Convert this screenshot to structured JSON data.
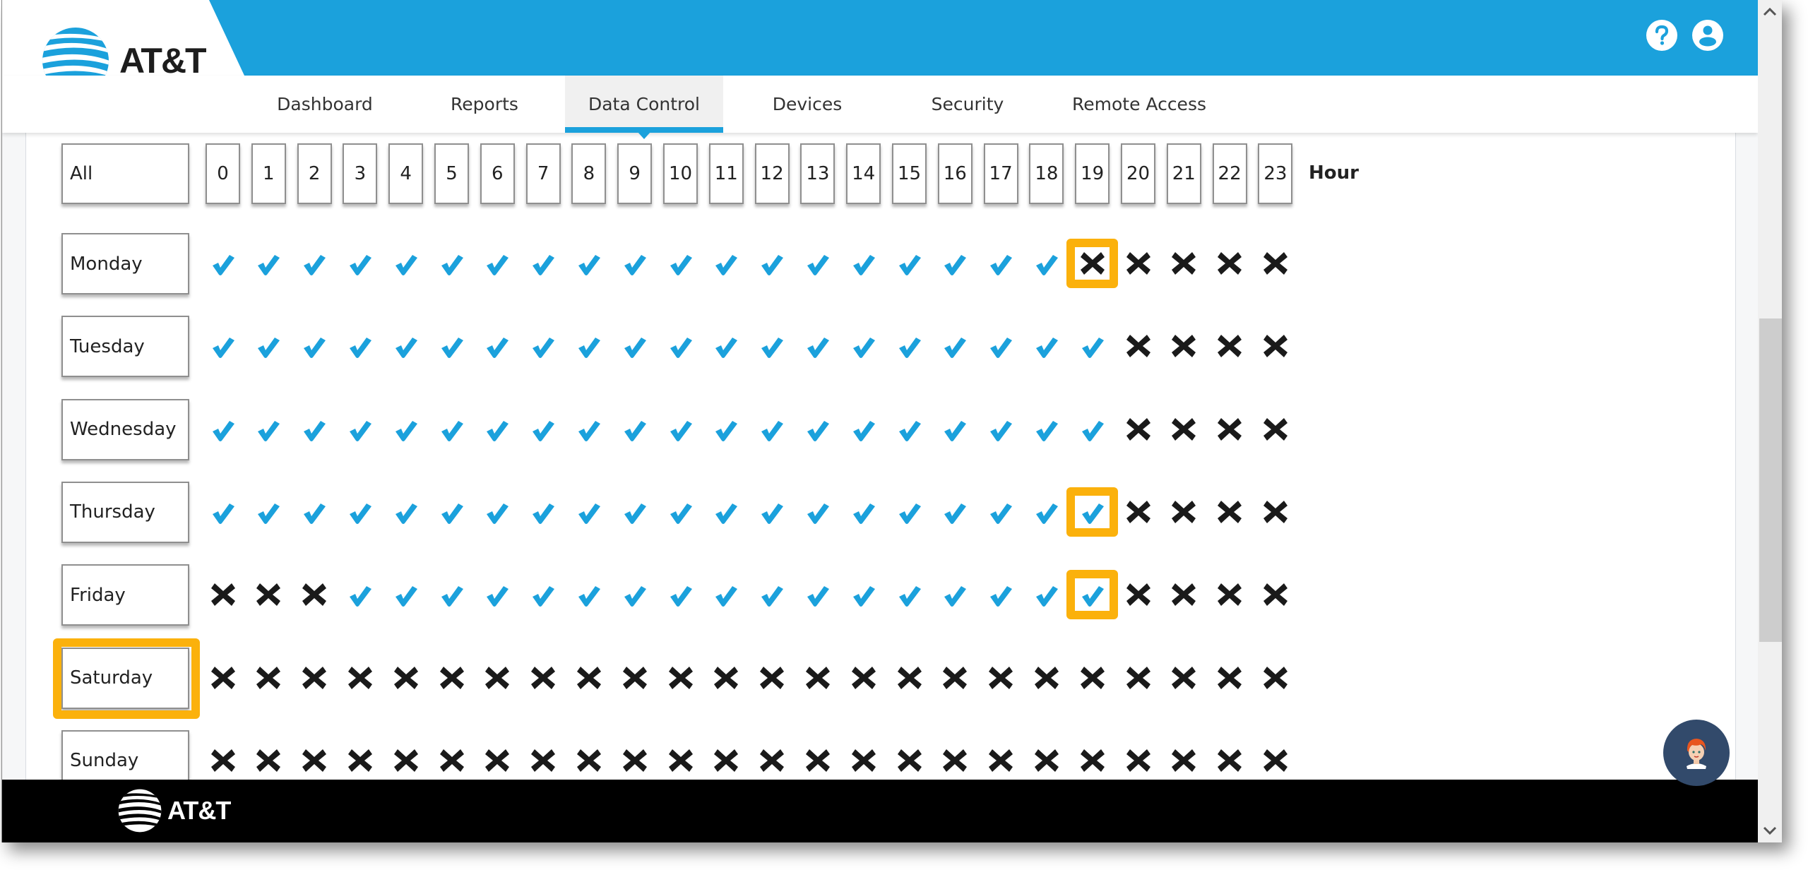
{
  "brand": {
    "logo_text": "AT&T",
    "primary_color": "#1ba1dc",
    "highlight_color": "#fbb10c"
  },
  "header": {
    "icons": [
      "help-icon",
      "profile-icon"
    ]
  },
  "nav": {
    "tabs": [
      {
        "label": "Dashboard",
        "active": false
      },
      {
        "label": "Reports",
        "active": false
      },
      {
        "label": "Data Control",
        "active": true
      },
      {
        "label": "Devices",
        "active": false
      },
      {
        "label": "Security",
        "active": false
      },
      {
        "label": "Remote Access",
        "active": false
      }
    ]
  },
  "schedule": {
    "all_label": "All",
    "hour_label": "Hour",
    "hours": [
      "0",
      "1",
      "2",
      "3",
      "4",
      "5",
      "6",
      "7",
      "8",
      "9",
      "10",
      "11",
      "12",
      "13",
      "14",
      "15",
      "16",
      "17",
      "18",
      "19",
      "20",
      "21",
      "22",
      "23"
    ],
    "days": [
      {
        "label": "Monday",
        "allowed": [
          1,
          1,
          1,
          1,
          1,
          1,
          1,
          1,
          1,
          1,
          1,
          1,
          1,
          1,
          1,
          1,
          1,
          1,
          1,
          0,
          0,
          0,
          0,
          0
        ]
      },
      {
        "label": "Tuesday",
        "allowed": [
          1,
          1,
          1,
          1,
          1,
          1,
          1,
          1,
          1,
          1,
          1,
          1,
          1,
          1,
          1,
          1,
          1,
          1,
          1,
          1,
          0,
          0,
          0,
          0
        ]
      },
      {
        "label": "Wednesday",
        "allowed": [
          1,
          1,
          1,
          1,
          1,
          1,
          1,
          1,
          1,
          1,
          1,
          1,
          1,
          1,
          1,
          1,
          1,
          1,
          1,
          1,
          0,
          0,
          0,
          0
        ]
      },
      {
        "label": "Thursday",
        "allowed": [
          1,
          1,
          1,
          1,
          1,
          1,
          1,
          1,
          1,
          1,
          1,
          1,
          1,
          1,
          1,
          1,
          1,
          1,
          1,
          1,
          0,
          0,
          0,
          0
        ]
      },
      {
        "label": "Friday",
        "allowed": [
          0,
          0,
          0,
          1,
          1,
          1,
          1,
          1,
          1,
          1,
          1,
          1,
          1,
          1,
          1,
          1,
          1,
          1,
          1,
          1,
          0,
          0,
          0,
          0
        ]
      },
      {
        "label": "Saturday",
        "allowed": [
          0,
          0,
          0,
          0,
          0,
          0,
          0,
          0,
          0,
          0,
          0,
          0,
          0,
          0,
          0,
          0,
          0,
          0,
          0,
          0,
          0,
          0,
          0,
          0
        ]
      },
      {
        "label": "Sunday",
        "allowed": [
          0,
          0,
          0,
          0,
          0,
          0,
          0,
          0,
          0,
          0,
          0,
          0,
          0,
          0,
          0,
          0,
          0,
          0,
          0,
          0,
          0,
          0,
          0,
          0
        ]
      }
    ],
    "highlighted_cells": [
      {
        "day": "Monday",
        "hour": "19"
      },
      {
        "day": "Thursday",
        "hour": "19"
      },
      {
        "day": "Friday",
        "hour": "19"
      }
    ],
    "highlighted_days": [
      "Saturday"
    ]
  },
  "footer": {
    "logo_text": "AT&T"
  },
  "chat": {
    "icon": "chat-assistant-avatar-icon"
  }
}
